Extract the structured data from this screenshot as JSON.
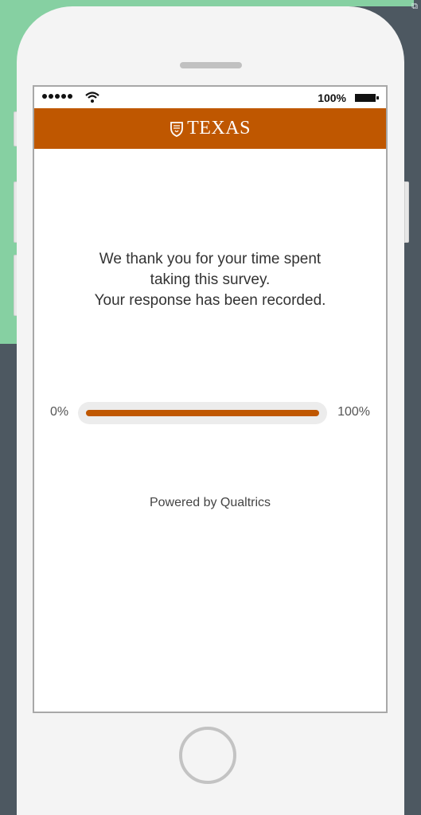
{
  "status_bar": {
    "battery_text": "100%"
  },
  "header": {
    "logo_text": "TEXAS",
    "brand_color": "#bf5700"
  },
  "message": {
    "line1": "We thank you for your time spent",
    "line2": "taking this survey.",
    "line3": "Your response has been recorded."
  },
  "progress": {
    "start_label": "0%",
    "end_label": "100%",
    "value_percent": 100
  },
  "footer": {
    "powered_by": "Powered by Qualtrics"
  },
  "icons": {
    "signal": "signal-dots-icon",
    "wifi": "wifi-icon",
    "battery": "battery-icon",
    "shield": "shield-icon",
    "home": "home-button"
  }
}
